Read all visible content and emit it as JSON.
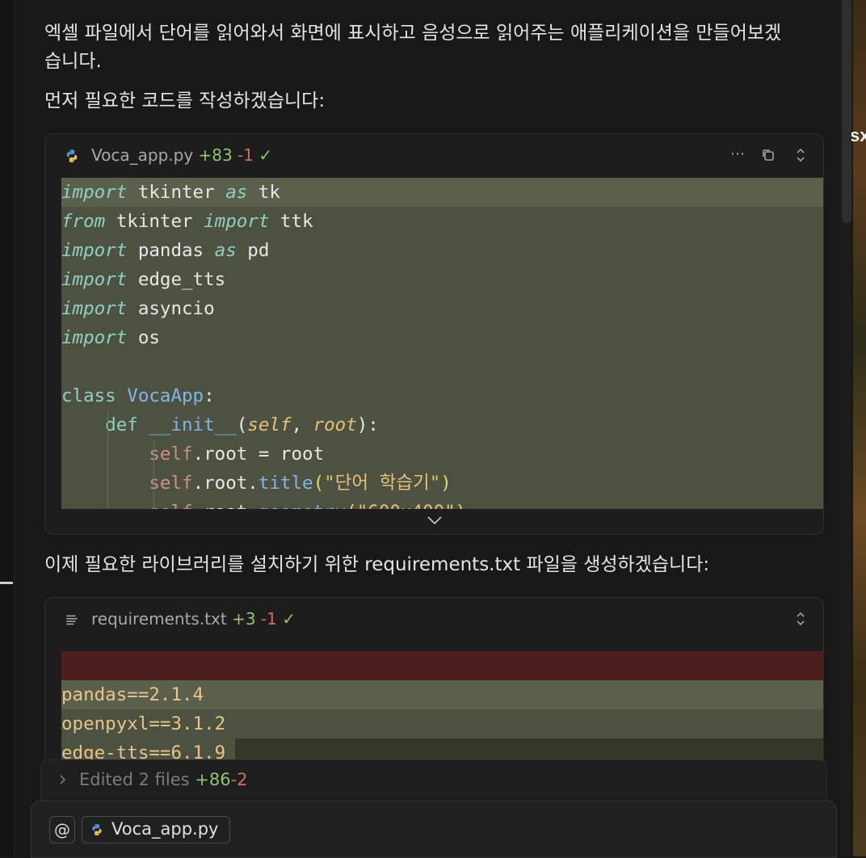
{
  "messages": {
    "intro_line1": "엑셀 파일에서 단어를 읽어와서 화면에 표시하고 음성으로 읽어주는 애플리케이션을 만들어보겠",
    "intro_line2": "습니다.",
    "intro_code": "먼저 필요한 코드를 작성하겠습니다:",
    "intro_req": "이제 필요한 라이브러리를 설치하기 위한 requirements.txt 파일을 생성하겠습니다:"
  },
  "file1": {
    "name": "Voca_app.py",
    "added": "+83",
    "removed": "-1",
    "check": "✓",
    "more_icon": "ellipsis-icon",
    "copy_icon": "copy-icon",
    "expand_icon": "chevron-up-down-icon"
  },
  "file2": {
    "name": "requirements.txt",
    "added": "+3",
    "removed": "-1",
    "check": "✓",
    "lines": [
      "pandas==2.1.4",
      "openpyxl==3.1.2",
      "edge-tts==6.1.9"
    ]
  },
  "edited_summary": {
    "label": "Edited 2 files",
    "added": "+86",
    "removed": "-2"
  },
  "composer": {
    "at_label": "@",
    "context_file": "Voca_app.py"
  },
  "background_text": "sx",
  "colors": {
    "added_line_bg": "#4c5140",
    "removed_line_bg": "#4a1f1e",
    "add_green": "#8fc46c",
    "del_red": "#d86767"
  }
}
